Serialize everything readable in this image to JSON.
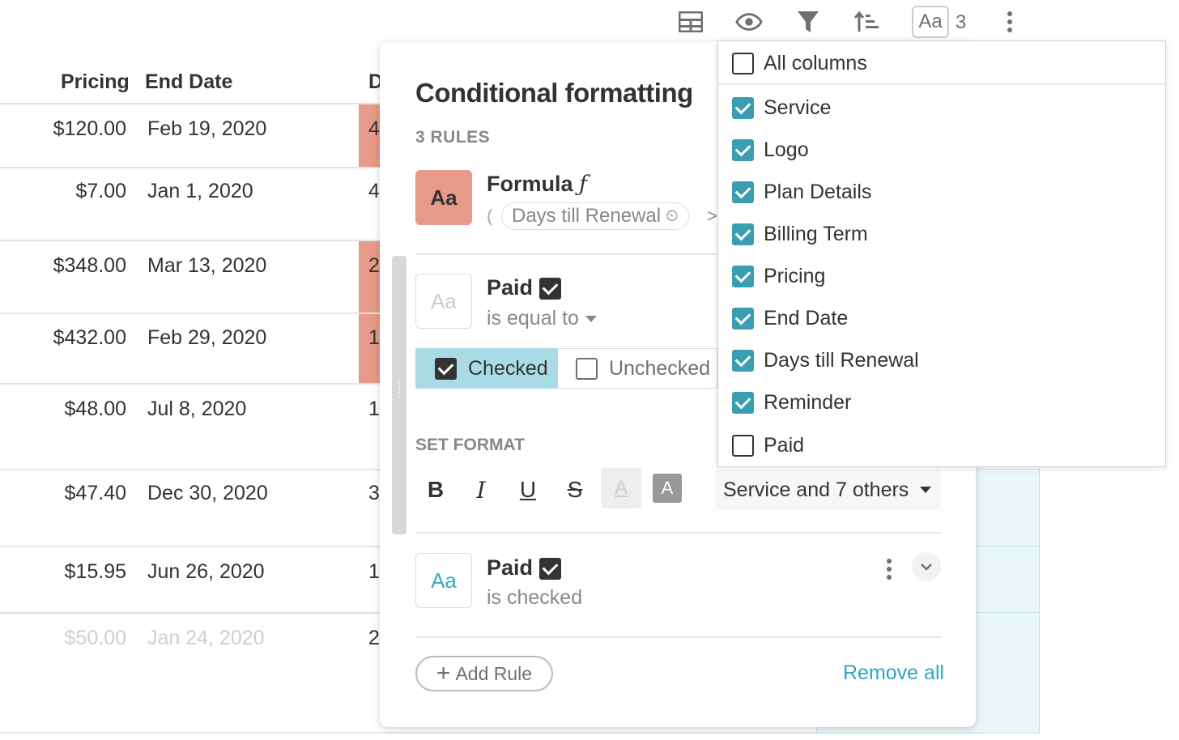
{
  "toolbar": {
    "icons": [
      "table-icon",
      "eye-icon",
      "filter-icon",
      "sort-icon"
    ],
    "format_label": "Aa",
    "format_count": "3"
  },
  "grid": {
    "headers": {
      "pricing": "Pricing",
      "end_date": "End Date",
      "days": "D"
    },
    "rows": [
      {
        "pricing": "$120.00",
        "end_date": "Feb 19, 2020",
        "days": "4"
      },
      {
        "pricing": "$7.00",
        "end_date": "Jan 1, 2020",
        "days": "4"
      },
      {
        "pricing": "$348.00",
        "end_date": "Mar 13, 2020",
        "days": "2"
      },
      {
        "pricing": "$432.00",
        "end_date": "Feb 29, 2020",
        "days": "1"
      },
      {
        "pricing": "$48.00",
        "end_date": "Jul 8, 2020",
        "days": "1"
      },
      {
        "pricing": "$47.40",
        "end_date": "Dec 30, 2020",
        "days": "3"
      },
      {
        "pricing": "$15.95",
        "end_date": "Jun 26, 2020",
        "days": "1"
      },
      {
        "pricing": "$50.00",
        "end_date": "Jan 24, 2020",
        "days": "2"
      }
    ]
  },
  "panel": {
    "title": "Conditional formatting",
    "rules_count": "3 RULES",
    "rule1": {
      "swatch": "Aa",
      "title": "Formula",
      "formula_prefix": "(",
      "formula_field": "Days till Renewal",
      "formula_op": ">"
    },
    "rule2": {
      "swatch": "Aa",
      "title": "Paid",
      "condition": "is equal to",
      "checked_label": "Checked",
      "unchecked_label": "Unchecked"
    },
    "set_format_label": "SET FORMAT",
    "format_buttons": [
      "B",
      "I",
      "U",
      "S",
      "A",
      "A"
    ],
    "apply_to": "Service and 7 others",
    "rule3": {
      "swatch": "Aa",
      "title": "Paid",
      "condition": "is checked"
    },
    "add_rule": "Add Rule",
    "remove_all": "Remove all"
  },
  "columns_dropdown": {
    "all_columns": "All columns",
    "items": [
      {
        "label": "Service",
        "checked": true
      },
      {
        "label": "Logo",
        "checked": true
      },
      {
        "label": "Plan Details",
        "checked": true
      },
      {
        "label": "Billing Term",
        "checked": true
      },
      {
        "label": "Pricing",
        "checked": true
      },
      {
        "label": "End Date",
        "checked": true
      },
      {
        "label": "Days till Renewal",
        "checked": true
      },
      {
        "label": "Reminder",
        "checked": true
      },
      {
        "label": "Paid",
        "checked": false
      }
    ]
  },
  "colors": {
    "accent": "#3a9eb2",
    "salmon": "#e89a88",
    "selected_segment": "#a9dbe6"
  }
}
